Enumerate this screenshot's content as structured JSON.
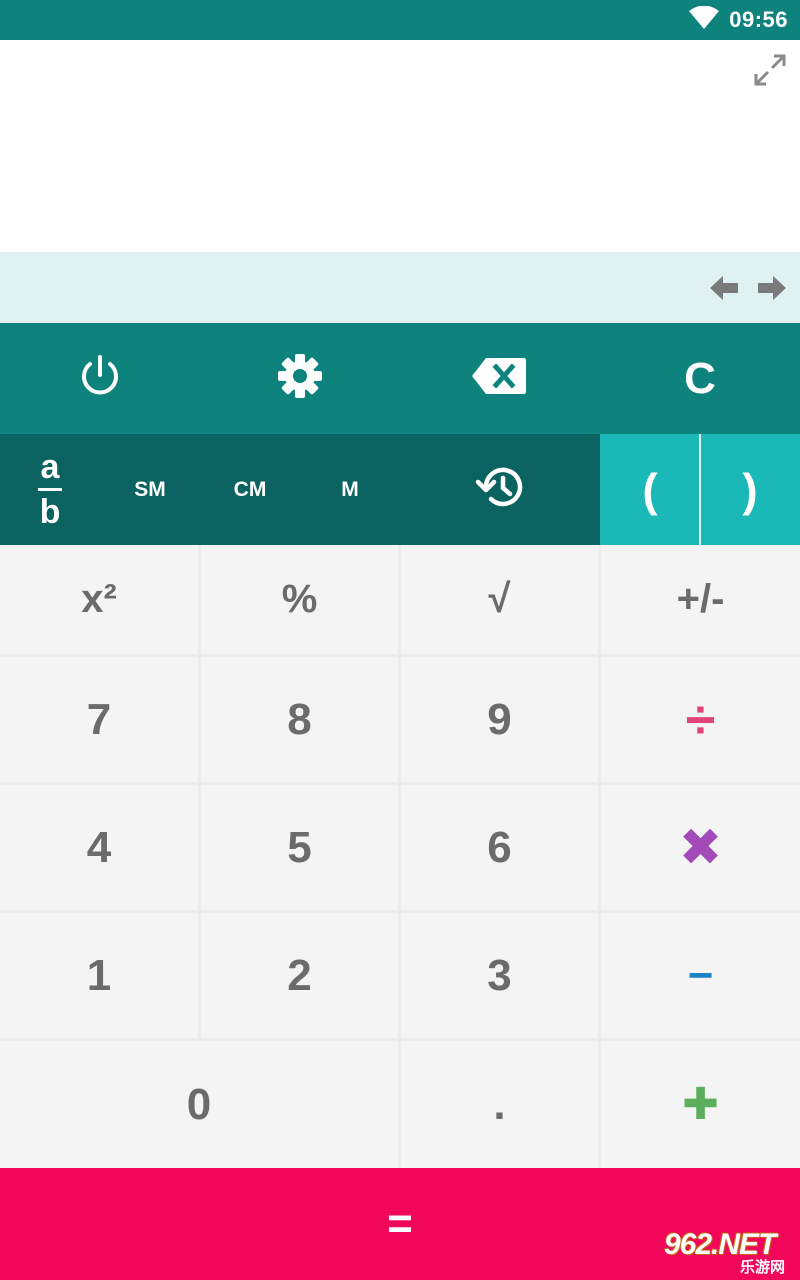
{
  "status_bar": {
    "time": "09:56",
    "wifi_icon": "wifi-icon",
    "background": "#0e837d"
  },
  "display": {
    "expression": "",
    "result": "",
    "expand_icon": "expand-icon",
    "history_nav": {
      "left_icon": "arrow-left-icon",
      "right_icon": "arrow-right-icon"
    }
  },
  "controls": {
    "power_icon": "power-icon",
    "settings_icon": "gear-icon",
    "backspace_icon": "backspace-icon",
    "clear_label": "C"
  },
  "mode_row": {
    "fraction": {
      "numerator": "a",
      "denominator": "b"
    },
    "memory_store": "SM",
    "memory_clear": "CM",
    "memory_recall": "M",
    "history_icon": "history-icon",
    "open_paren": "(",
    "close_paren": ")"
  },
  "keypad": {
    "square": "x²",
    "percent": "%",
    "sqrt": "√",
    "negate": "+/-",
    "seven": "7",
    "eight": "8",
    "nine": "9",
    "divide": "÷",
    "four": "4",
    "five": "5",
    "six": "6",
    "multiply": "✖",
    "one": "1",
    "two": "2",
    "three": "3",
    "subtract": "−",
    "zero": "0",
    "decimal": ".",
    "add": "✚"
  },
  "equals_label": "=",
  "watermark": {
    "main": "962.NET",
    "sub": "乐游网"
  },
  "colors": {
    "primary": "#0e837d",
    "primary_dark": "#0a6361",
    "accent_teal": "#1ab8b6",
    "equals": "#f2065a",
    "divide": "#e0447a",
    "multiply": "#a24ab8",
    "subtract": "#1d83c6",
    "add": "#5bae5b"
  }
}
